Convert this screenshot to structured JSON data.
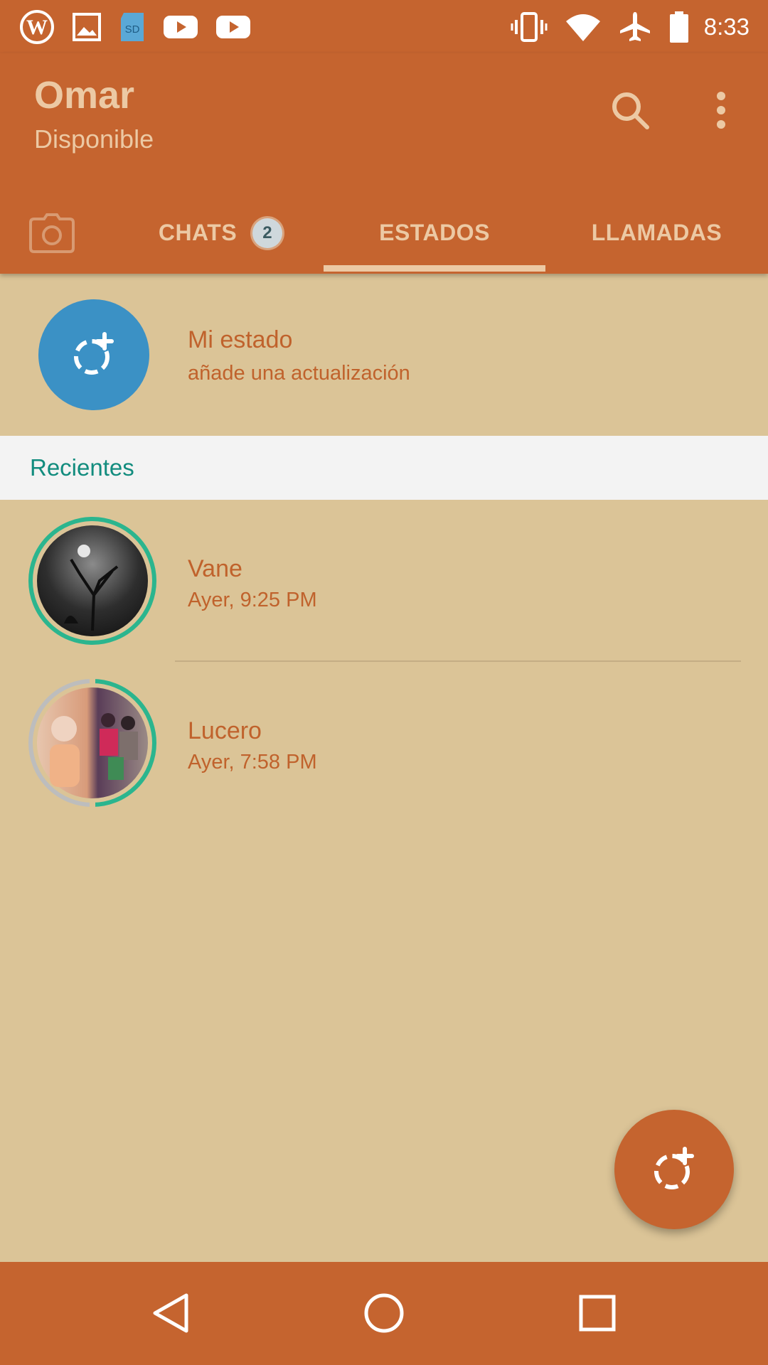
{
  "status_bar": {
    "time": "8:33",
    "left_icons": [
      "wordpress-icon",
      "gallery-icon",
      "sd-card-icon",
      "youtube-icon",
      "youtube-icon"
    ],
    "sd_label": "SD",
    "right_icons": [
      "vibrate-icon",
      "wifi-icon",
      "airplane-icon",
      "battery-icon"
    ]
  },
  "header": {
    "title": "Omar",
    "subtitle": "Disponible",
    "actions": [
      "search-icon",
      "more-vert-icon"
    ]
  },
  "tabs": [
    {
      "id": "camera",
      "icon": "camera-icon"
    },
    {
      "id": "chats",
      "label": "CHATS",
      "badge": "2"
    },
    {
      "id": "estados",
      "label": "ESTADOS",
      "selected": true
    },
    {
      "id": "llamadas",
      "label": "LLAMADAS"
    }
  ],
  "my_status": {
    "title": "Mi estado",
    "subtitle": "añade una actualización",
    "icon": "add-status-icon"
  },
  "recent_section": {
    "title": "Recientes",
    "items": [
      {
        "name": "Vane",
        "time": "Ayer, 9:25 PM",
        "updates_viewed": "1 of 1"
      },
      {
        "name": "Lucero",
        "time": "Ayer, 7:58 PM",
        "updates_viewed": "1 of 2"
      }
    ]
  },
  "fab": {
    "icon": "add-status-icon"
  },
  "nav_bar": {
    "icons": [
      "back-icon",
      "home-icon",
      "recents-icon"
    ]
  },
  "colors": {
    "primary": "#c5642f",
    "background": "#dbc497",
    "header_text": "#ecc9a4",
    "accent_teal": "#128c7e",
    "status_avatar_blue": "#3b91c5",
    "ring_unseen": "#2bb58e",
    "ring_seen": "#bdbdbd"
  }
}
